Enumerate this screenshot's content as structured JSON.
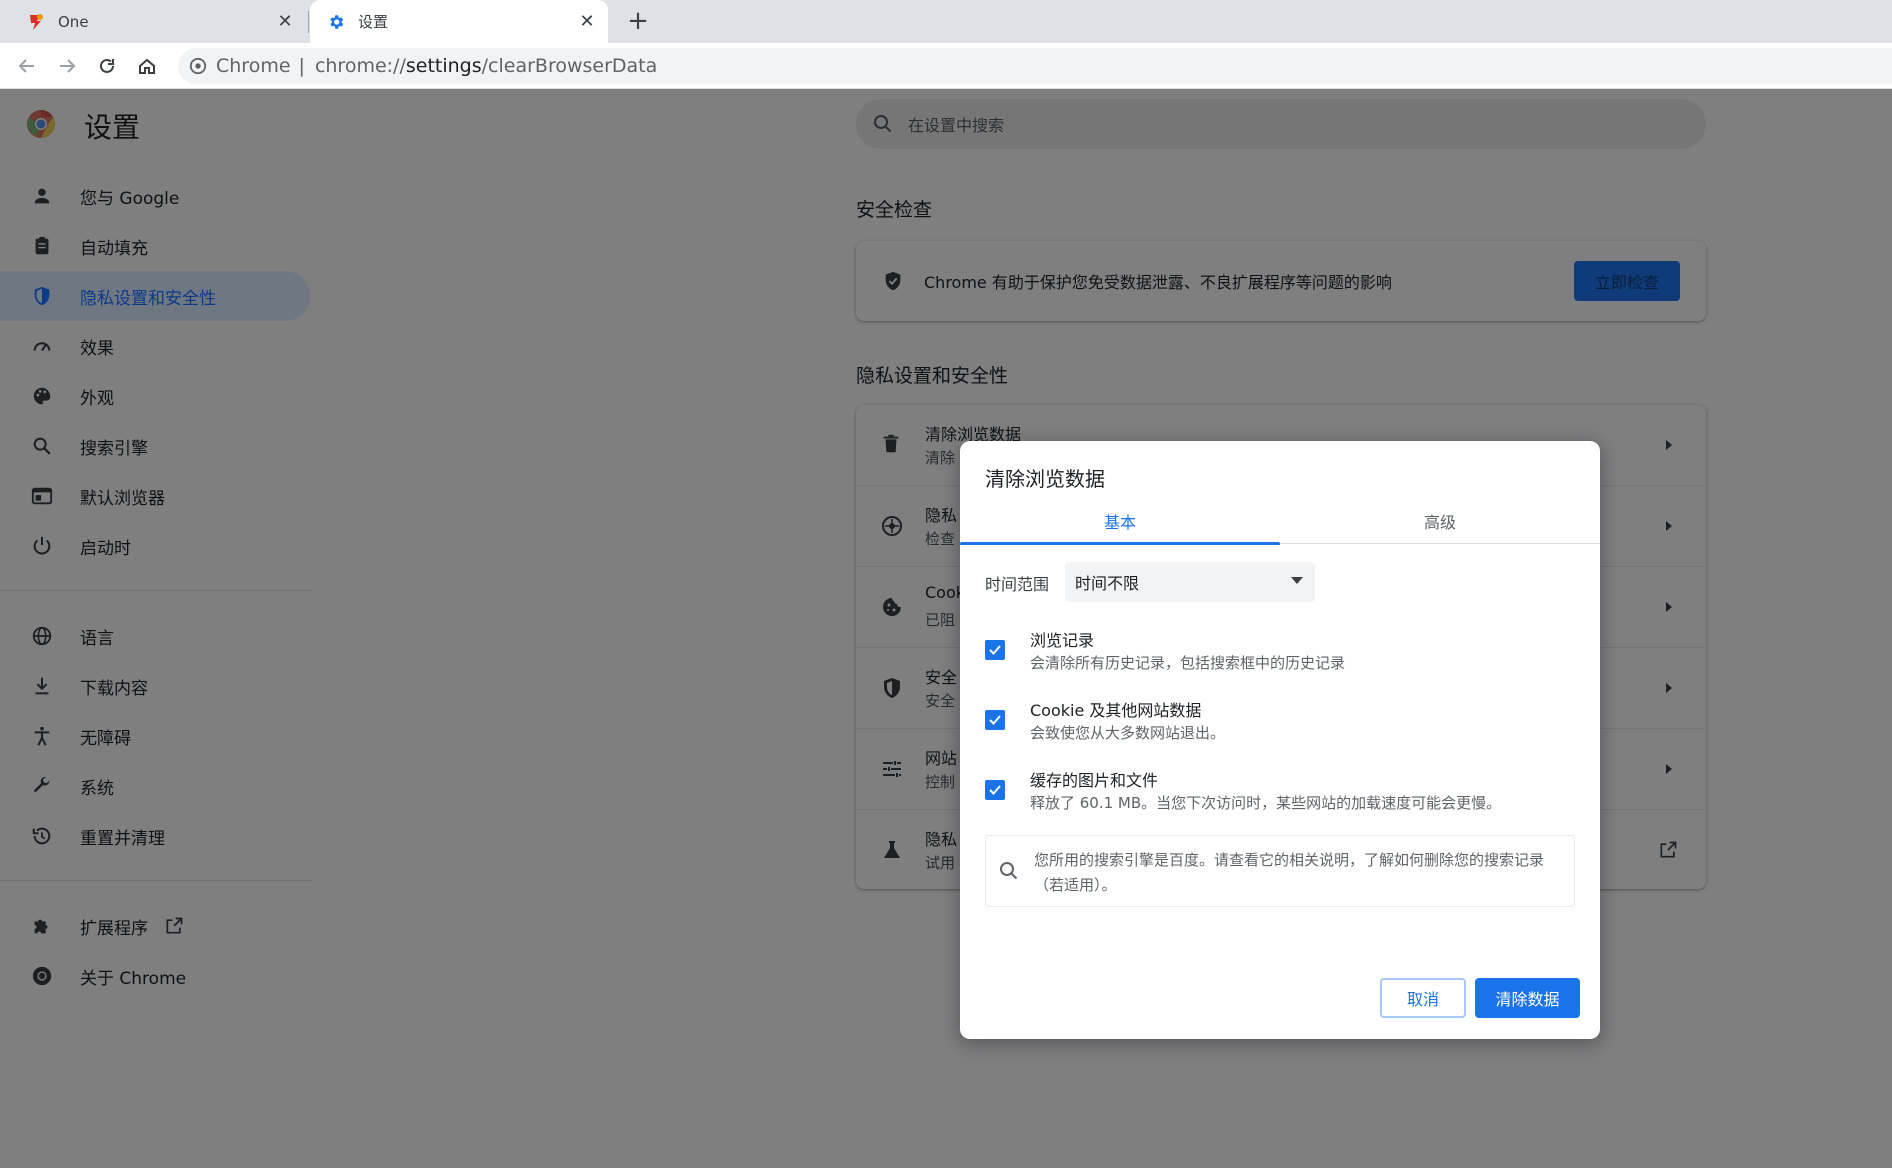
{
  "browser": {
    "tabs": [
      {
        "title": "One",
        "favicon": "one-logo-icon"
      },
      {
        "title": "设置",
        "favicon": "gear-icon"
      }
    ],
    "omnibox": {
      "scheme_label": "Chrome",
      "url_prefix": "chrome://",
      "url_host": "settings",
      "url_path": "/clearBrowserData"
    }
  },
  "settings": {
    "title": "设置",
    "search_placeholder": "在设置中搜索",
    "nav": {
      "group1": [
        {
          "label": "您与 Google",
          "icon": "person-icon"
        },
        {
          "label": "自动填充",
          "icon": "clipboard-icon"
        },
        {
          "label": "隐私设置和安全性",
          "icon": "shield-icon",
          "active": true
        },
        {
          "label": "效果",
          "icon": "speedometer-icon"
        },
        {
          "label": "外观",
          "icon": "palette-icon"
        },
        {
          "label": "搜索引擎",
          "icon": "search-icon"
        },
        {
          "label": "默认浏览器",
          "icon": "browser-window-icon"
        },
        {
          "label": "启动时",
          "icon": "power-icon"
        }
      ],
      "group2": [
        {
          "label": "语言",
          "icon": "globe-icon"
        },
        {
          "label": "下载内容",
          "icon": "download-icon"
        },
        {
          "label": "无障碍",
          "icon": "accessibility-icon"
        },
        {
          "label": "系统",
          "icon": "wrench-icon"
        },
        {
          "label": "重置并清理",
          "icon": "history-icon"
        }
      ],
      "group3": [
        {
          "label": "扩展程序",
          "icon": "puzzle-icon"
        },
        {
          "label": "关于 Chrome",
          "icon": "chrome-icon"
        }
      ]
    },
    "safety_check": {
      "heading": "安全检查",
      "text": "Chrome 有助于保护您免受数据泄露、不良扩展程序等问题的影响",
      "button": "立即检查"
    },
    "privacy": {
      "heading": "隐私设置和安全性",
      "rows": [
        {
          "title": "清除浏览数据",
          "sub": "清除",
          "icon": "trash-icon"
        },
        {
          "title": "隐私",
          "sub": "检查",
          "icon": "compass-icon"
        },
        {
          "title": "Cook",
          "sub": "已阻",
          "icon": "cookie-icon"
        },
        {
          "title": "安全",
          "sub": "安全",
          "icon": "shield-icon"
        },
        {
          "title": "网站",
          "sub": "控制",
          "icon": "tune-icon"
        },
        {
          "title": "隐私",
          "sub": "试用",
          "icon": "flask-icon"
        }
      ]
    }
  },
  "dialog": {
    "title": "清除浏览数据",
    "tabs": [
      "基本",
      "高级"
    ],
    "time_range_label": "时间范围",
    "time_range_value": "时间不限",
    "options": [
      {
        "title": "浏览记录",
        "sub": "会清除所有历史记录，包括搜索框中的历史记录",
        "checked": true
      },
      {
        "title": "Cookie 及其他网站数据",
        "sub": "会致使您从大多数网站退出。",
        "checked": true
      },
      {
        "title": "缓存的图片和文件",
        "sub": "释放了 60.1 MB。当您下次访问时，某些网站的加载速度可能会更慢。",
        "checked": true
      }
    ],
    "note": "您所用的搜索引擎是百度。请查看它的相关说明，了解如何删除您的搜索记录（若适用）。",
    "cancel_label": "取消",
    "clear_label": "清除数据"
  },
  "colors": {
    "accent": "#1a73e8",
    "scrim": "#7f7f80"
  }
}
